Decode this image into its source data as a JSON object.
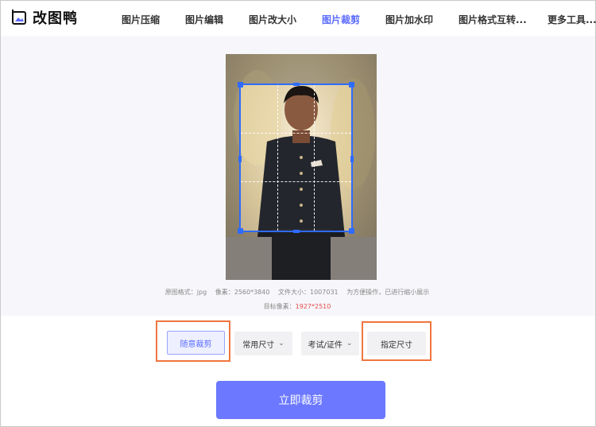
{
  "app": {
    "title": "改图鸭"
  },
  "nav": [
    {
      "label": "图片压缩"
    },
    {
      "label": "图片编辑"
    },
    {
      "label": "图片改大小"
    },
    {
      "label": "图片裁剪"
    },
    {
      "label": "图片加水印"
    },
    {
      "label": "图片格式互转..."
    },
    {
      "label": "更多工具..."
    }
  ],
  "active_nav": "图片裁剪",
  "image_info": {
    "format_label": "原图格式：jpg",
    "pixels_label": "像素：2560*3840",
    "filesize_label": "文件大小：1007031",
    "note": "为方便操作，已进行缩小展示",
    "target_label": "目标像素：",
    "target_value": "1927*2510"
  },
  "options": {
    "free_crop": "随意裁剪",
    "common_size": "常用尺寸",
    "exam_id": "考试/证件",
    "specified_size": "指定尺寸"
  },
  "submit_label": "立即裁剪",
  "colors": {
    "accent": "#5b6bff",
    "submit": "#6b78ff",
    "crop_border": "#2f6bff",
    "highlight": "#f0763f",
    "target_value": "#e84a4a"
  }
}
